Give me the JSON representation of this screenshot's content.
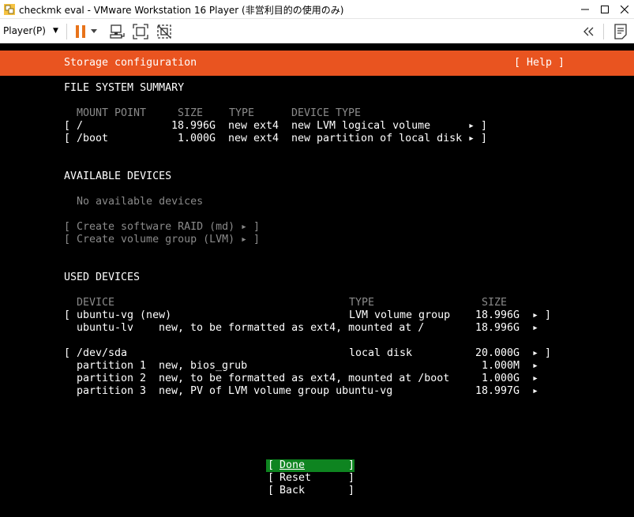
{
  "window": {
    "title": "checkmk eval - VMware Workstation 16 Player (非営利目的の使用のみ)",
    "icons": [
      "vmware-logo-icon",
      "minimize-icon",
      "maximize-icon",
      "close-icon"
    ]
  },
  "toolbar": {
    "player_label": "Player(P)",
    "icons": [
      "pause-icon",
      "dropdown-arrow-icon",
      "send-ctrl-alt-del-icon",
      "fit-guest-icon",
      "unity-icon",
      "back-icon",
      "notes-icon"
    ]
  },
  "header": {
    "title": "Storage configuration",
    "help": "[ Help ]"
  },
  "fs_summary": {
    "heading": "FILE SYSTEM SUMMARY",
    "columns": [
      "MOUNT POINT",
      "SIZE",
      "TYPE",
      "DEVICE TYPE"
    ],
    "rows": [
      {
        "mount": "/",
        "size": "18.996G",
        "type": "new ext4",
        "device_type": "new LVM logical volume"
      },
      {
        "mount": "/boot",
        "size": "1.000G",
        "type": "new ext4",
        "device_type": "new partition of local disk"
      }
    ]
  },
  "available": {
    "heading": "AVAILABLE DEVICES",
    "empty_text": "No available devices",
    "actions": [
      "Create software RAID (md)",
      "Create volume group (LVM)"
    ]
  },
  "used": {
    "heading": "USED DEVICES",
    "columns": [
      "DEVICE",
      "TYPE",
      "SIZE"
    ],
    "groups": [
      {
        "device": "ubuntu-vg (new)",
        "type": "LVM volume group",
        "size": "18.996G",
        "children": [
          {
            "name": "ubuntu-lv",
            "desc": "new, to be formatted as ext4, mounted at /",
            "size": "18.996G"
          }
        ]
      },
      {
        "device": "/dev/sda",
        "type": "local disk",
        "size": "20.000G",
        "children": [
          {
            "name": "partition 1",
            "desc": "new, bios_grub",
            "size": "1.000M"
          },
          {
            "name": "partition 2",
            "desc": "new, to be formatted as ext4, mounted at /boot",
            "size": "1.000G"
          },
          {
            "name": "partition 3",
            "desc": "new, PV of LVM volume group ubuntu-vg",
            "size": "18.997G"
          }
        ]
      }
    ]
  },
  "buttons": {
    "done": "Done",
    "reset": "Reset",
    "back": "Back"
  },
  "colors": {
    "header": "#e95420",
    "done_button": "#0e8420",
    "background": "#000000"
  }
}
